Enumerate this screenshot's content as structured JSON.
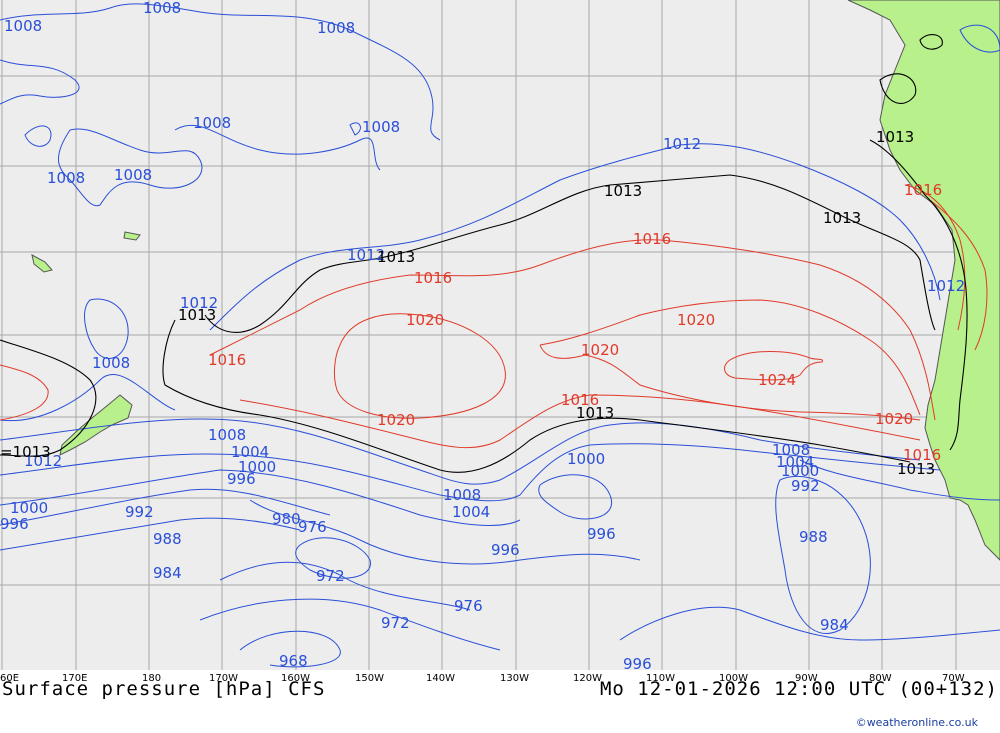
{
  "title": "Surface pressure [hPa] CFS",
  "valid_time": "Mo 12-01-2026 12:00 UTC (00+132)",
  "credit": "©weatheronline.co.uk",
  "colors": {
    "low": "#2a4fd8",
    "high": "#e03a2a",
    "ref": "#000000",
    "land": "#b8f08c",
    "sea": "#ededed",
    "grid": "#a8a8a8"
  },
  "longitude_labels": [
    "60E",
    "170E",
    "180",
    "170W",
    "160W",
    "150W",
    "140W",
    "130W",
    "120W",
    "110W",
    "100W",
    "90W",
    "80W",
    "70W"
  ],
  "isobar_labels": {
    "l1008a": "1008",
    "l1008b": "1008",
    "l1008c": "1008",
    "l1008d": "1008",
    "l1008e": "1008",
    "l1008f": "1008",
    "l1008g": "1008",
    "l1008h": "1008",
    "l1008i": "1008",
    "l1008j": "1008",
    "l1008k": "1008",
    "l1012a": "1012",
    "l1012b": "1012",
    "l1012c": "1012",
    "l1012d": "1012",
    "l1012e": "1012",
    "l1013a": "1013",
    "l1013b": "1013",
    "l1013c": "1013",
    "l1013d": "1013",
    "l1013e": "1013",
    "l1013f": "1013",
    "l1013g": "=1013",
    "l1016a": "1016",
    "l1016b": "1016",
    "l1016c": "1016",
    "l1016d": "1016",
    "l1016e": "1016",
    "l1016f": "1016",
    "l1020a": "1020",
    "l1020b": "1020",
    "l1020c": "1020",
    "l1020d": "1020",
    "l1020e": "1020",
    "l1024": "1024",
    "l1004a": "1004",
    "l1004b": "1004",
    "l1004c": "1004",
    "l1000a": "1000",
    "l1000b": "1000",
    "l1000c": "1000",
    "l1000d": "1000",
    "l996a": "996",
    "l996b": "996",
    "l996c": "996",
    "l996d": "996",
    "l996e": "996",
    "l992a": "992",
    "l992b": "992",
    "l988a": "988",
    "l988b": "988",
    "l984a": "984",
    "l984b": "984",
    "l980": "980",
    "l976a": "976",
    "l976b": "976",
    "l972a": "972",
    "l972b": "972",
    "l968": "968"
  }
}
